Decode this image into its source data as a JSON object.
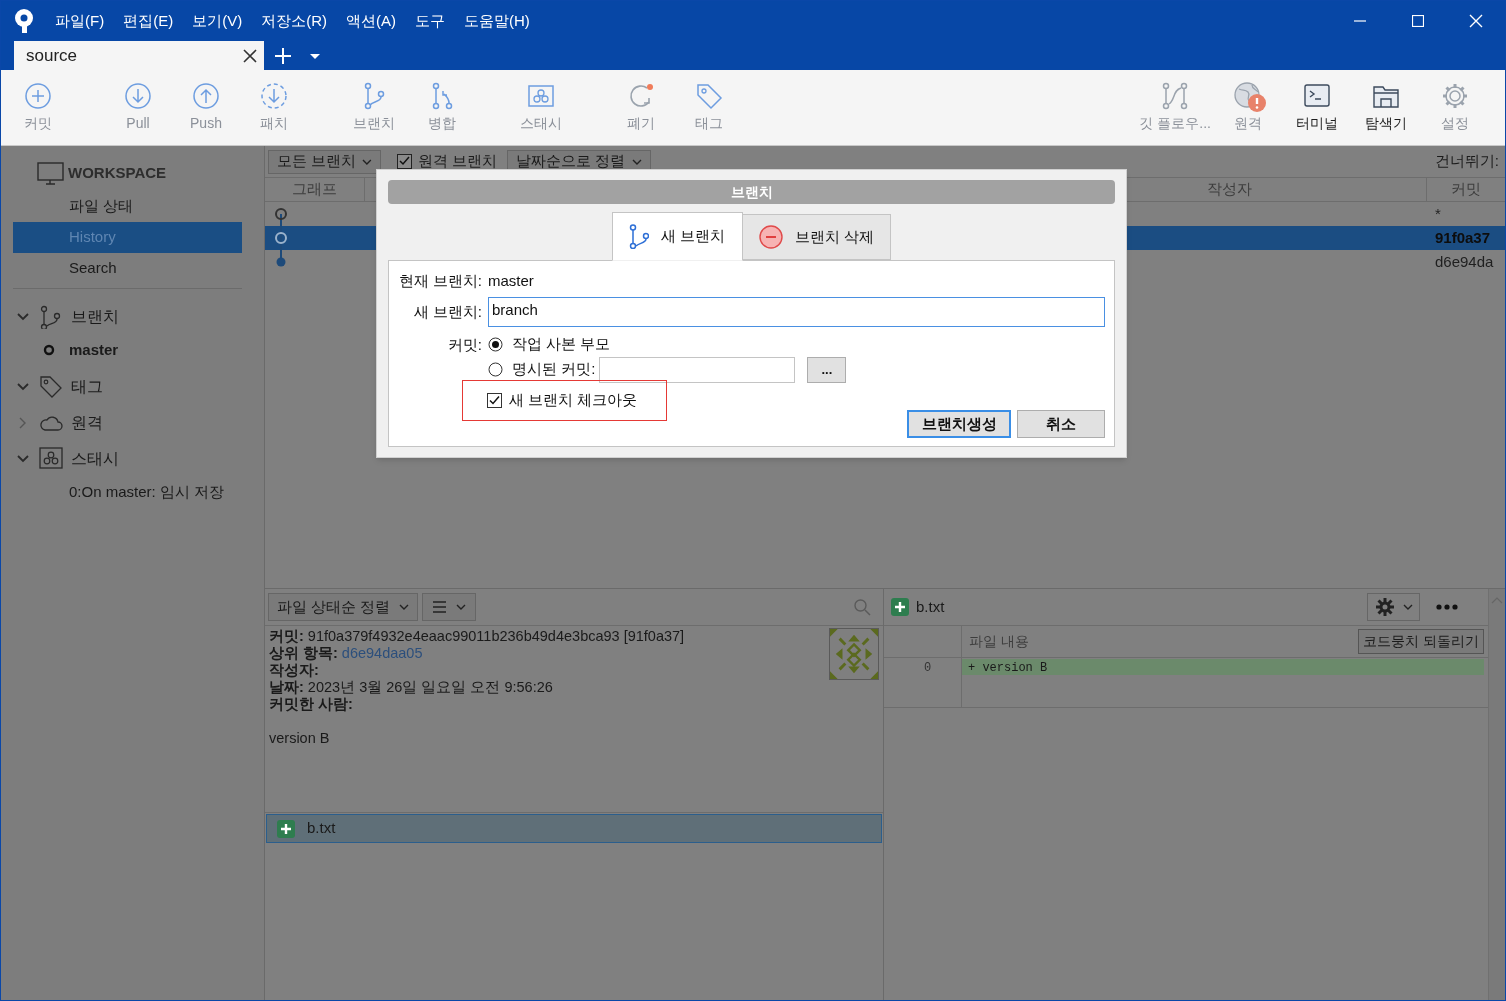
{
  "menu": [
    "파일(F)",
    "편집(E)",
    "보기(V)",
    "저장소(R)",
    "액션(A)",
    "도구",
    "도움말(H)"
  ],
  "tabs": [
    {
      "label": "source",
      "selected": true
    }
  ],
  "toolbar": {
    "left": [
      {
        "label": "커밋",
        "disabled": true
      },
      {
        "label": "Pull",
        "disabled": true
      },
      {
        "label": "Push",
        "disabled": true
      },
      {
        "label": "패치",
        "disabled": true
      },
      {
        "label": "브랜치",
        "disabled": true
      },
      {
        "label": "병합",
        "disabled": true
      },
      {
        "label": "스태시",
        "disabled": true
      },
      {
        "label": "폐기",
        "disabled": true
      },
      {
        "label": "태그",
        "disabled": true
      }
    ],
    "right": [
      {
        "label": "깃 플로우...",
        "disabled": true,
        "warning": false
      },
      {
        "label": "원격",
        "disabled": true,
        "warning": true
      },
      {
        "label": "터미널",
        "disabled": false,
        "warning": false
      },
      {
        "label": "탐색기",
        "disabled": false,
        "warning": false
      },
      {
        "label": "설정",
        "disabled": true,
        "warning": false
      }
    ]
  },
  "sidebar": {
    "workspace": "WORKSPACE",
    "items": [
      {
        "label": "파일 상태",
        "selected": false
      },
      {
        "label": "History",
        "selected": true
      },
      {
        "label": "Search",
        "selected": false
      }
    ],
    "sections": [
      {
        "label": "브랜치",
        "expanded": true,
        "children": [
          {
            "label": "master",
            "current": true
          }
        ]
      },
      {
        "label": "태그",
        "expanded": true
      },
      {
        "label": "원격",
        "expanded": false
      },
      {
        "label": "스태시",
        "expanded": true,
        "children": [
          {
            "label": "0:On master: 임시 저장",
            "current": false
          }
        ]
      }
    ]
  },
  "history": {
    "branch_filter": "모든 브랜치",
    "remote_branches": {
      "label": "원격 브랜치",
      "checked": true
    },
    "sort": "날짜순으로 정렬",
    "jump": "건너뛰기:",
    "columns": [
      "그래프",
      "작성자",
      "커밋"
    ],
    "rows": [
      {
        "kind": "working",
        "commit": "*",
        "selected": false
      },
      {
        "kind": "head",
        "commit": "91f0a37",
        "selected": true
      },
      {
        "kind": "commit",
        "commit": "d6e94da",
        "selected": false
      }
    ]
  },
  "details": {
    "sort": "파일 상태순 정렬",
    "lines": [
      {
        "label": "커밋:",
        "value": "91f0a379f4932e4eaac99011b236b49d4e3bca93 [91f0a37]",
        "kind": "text"
      },
      {
        "label": "상위 항목:",
        "value": "d6e94daa05",
        "kind": "link"
      },
      {
        "label": "작성자:"
      },
      {
        "label": "날짜:",
        "value": "2023년 3월 26일 일요일 오전 9:56:26",
        "kind": "text"
      },
      {
        "label": "커밋한 사람:"
      }
    ],
    "message": "version B",
    "files": [
      {
        "name": "b.txt",
        "selected": true
      }
    ]
  },
  "diff": {
    "file": "b.txt",
    "header": "파일 내용",
    "revert": "코드뭉치 되돌리기",
    "lines": [
      {
        "number": "0",
        "text": "+ version B"
      }
    ]
  },
  "dialog": {
    "title": "브랜치",
    "tabs": [
      {
        "label": "새 브랜치",
        "selected": true
      },
      {
        "label": "브랜치 삭제",
        "selected": false
      }
    ],
    "current_label": "현재 브랜치:",
    "current": "master",
    "new_label": "새 브랜치:",
    "new_branch": "branch",
    "commit_label": "커밋:",
    "commit_options": [
      {
        "label": "작업 사본 부모",
        "selected": true
      },
      {
        "label": "명시된 커밋:",
        "selected": false
      }
    ],
    "browse": "...",
    "checkout": {
      "label": "새 브랜치 체크아웃",
      "checked": true,
      "highlighted": true
    },
    "buttons": [
      {
        "label": "브랜치생성",
        "default": true
      },
      {
        "label": "취소",
        "default": false
      }
    ]
  }
}
